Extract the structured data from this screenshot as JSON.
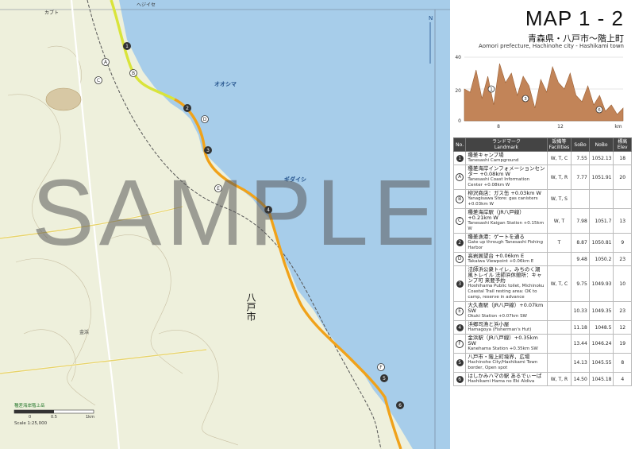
{
  "header": {
    "title": "MAP 1 - 2",
    "subtitle_jp": "青森県・八戸市～階上町",
    "subtitle_en": "Aomori prefecture, Hachinohe city - Hashikami town"
  },
  "map": {
    "place_labels": {
      "city": "八戸市",
      "oshima": "オオシマ",
      "station_label": "種差海岸階上岳",
      "scale": "Scale 1:25,000",
      "scale_zero": "0",
      "scale_half": "0.5",
      "scale_one": "1km",
      "north": "N",
      "hejisei": "ヘジイセ",
      "kabuto": "カブト",
      "gidaishi": "ギダイシ",
      "kinpama": "金浜"
    },
    "markers": [
      "1",
      "2",
      "3",
      "4",
      "5",
      "6",
      "A",
      "B",
      "C",
      "D",
      "E",
      "F"
    ],
    "colors": {
      "sea": "#a7cdea",
      "land": "#eef0dc",
      "route": "#f0a21a",
      "route_green": "#d9e43a"
    }
  },
  "profile": {
    "y_ticks": [
      "40",
      "20",
      "0"
    ],
    "x_ticks": [
      "8",
      "12",
      "km"
    ],
    "markers": [
      "1",
      "3",
      "6"
    ],
    "elevation_m": [
      20,
      18,
      32,
      14,
      28,
      10,
      36,
      24,
      30,
      16,
      28,
      22,
      8,
      26,
      18,
      34,
      24,
      20,
      30,
      16,
      12,
      22,
      10,
      16,
      6,
      10,
      4,
      8
    ],
    "colors": {
      "fill": "#c28458"
    }
  },
  "table": {
    "headers": {
      "no": "No.",
      "lm_jp": "ランドマーク",
      "lm_en": "Landmark",
      "fac_jp": "設備等",
      "fac_en": "Facilities",
      "sobo": "SoBo",
      "nobo": "NoBo",
      "elev_jp": "標高",
      "elev_en": "Elev"
    },
    "rows": [
      {
        "mark": "1",
        "style": "filled",
        "jp": "種差キャンプ場",
        "en": "Tanesashi Campground",
        "fac": "W, T, C",
        "sobo": "7.55",
        "nobo": "1052.13",
        "elev": "18"
      },
      {
        "mark": "A",
        "style": "open",
        "jp": "種差海岸インフォメーションセンター +0.08km W",
        "en": "Tanesashi Coast Information Center +0.08km W",
        "fac": "W, T, R",
        "sobo": "7.77",
        "nobo": "1051.91",
        "elev": "20"
      },
      {
        "mark": "B",
        "style": "open",
        "jp": "柳沢商店：ガス缶 +0.03km W",
        "en": "Yanagisawa Store: gas canisters +0.03km W",
        "fac": "W, T, S",
        "sobo": "",
        "nobo": "",
        "elev": ""
      },
      {
        "mark": "C",
        "style": "open",
        "jp": "種差海岸駅（JR八戸線）+0.21km W",
        "en": "Tanesashi Kaigan Station +0.15km W",
        "fac": "W, T",
        "sobo": "7.98",
        "nobo": "1051.7",
        "elev": "13"
      },
      {
        "mark": "2",
        "style": "filled",
        "jp": "種差漁港：ゲートを通る",
        "en": "Gate up through Tanesashi Fishing Harbor",
        "fac": "T",
        "sobo": "8.87",
        "nobo": "1050.81",
        "elev": "9"
      },
      {
        "mark": "D",
        "style": "open",
        "jp": "高岩展望台 +0.06km E",
        "en": "Takaiwa Viewpoint +0.06km E",
        "fac": "",
        "sobo": "9.48",
        "nobo": "1050.2",
        "elev": "23"
      },
      {
        "mark": "3",
        "style": "filled",
        "jp": "法師浜公衆トイレ，みちのく潮風トレイル 法師浜休憩所：キャンプ可 来要予約",
        "en": "Hoshihama Public toilet, Michinoku Coastal Trail resting area: OK to camp, reserve in advance",
        "fac": "W, T, C",
        "sobo": "9.75",
        "nobo": "1049.93",
        "elev": "10"
      },
      {
        "mark": "E",
        "style": "open",
        "jp": "大久喜駅（JR八戸線）+0.07km SW",
        "en": "Okuki Station +0.07km SW",
        "fac": "",
        "sobo": "10.33",
        "nobo": "1049.35",
        "elev": "23"
      },
      {
        "mark": "4",
        "style": "filled",
        "jp": "浜郷司漁と浜小屋",
        "en": "Hamagoya (Fisherman's Hut)",
        "fac": "",
        "sobo": "11.18",
        "nobo": "1048.5",
        "elev": "12"
      },
      {
        "mark": "F",
        "style": "open",
        "jp": "金浜駅（JR八戸線）+0.35km SW",
        "en": "Kanehama Station +0.35km SW",
        "fac": "",
        "sobo": "13.44",
        "nobo": "1046.24",
        "elev": "19"
      },
      {
        "mark": "5",
        "style": "filled",
        "jp": "八戸市・階上町境界，広場",
        "en": "Hachinohe City/Hashikami Town border, Open spot",
        "fac": "",
        "sobo": "14.13",
        "nobo": "1045.55",
        "elev": "8"
      },
      {
        "mark": "6",
        "style": "filled",
        "jp": "はしかみハマの駅 あるでぃーば",
        "en": "Hashikami Hama no Eki Aldiva",
        "fac": "W, T, R",
        "sobo": "14.50",
        "nobo": "1045.18",
        "elev": "4"
      }
    ]
  },
  "watermark": "SAMPLE"
}
